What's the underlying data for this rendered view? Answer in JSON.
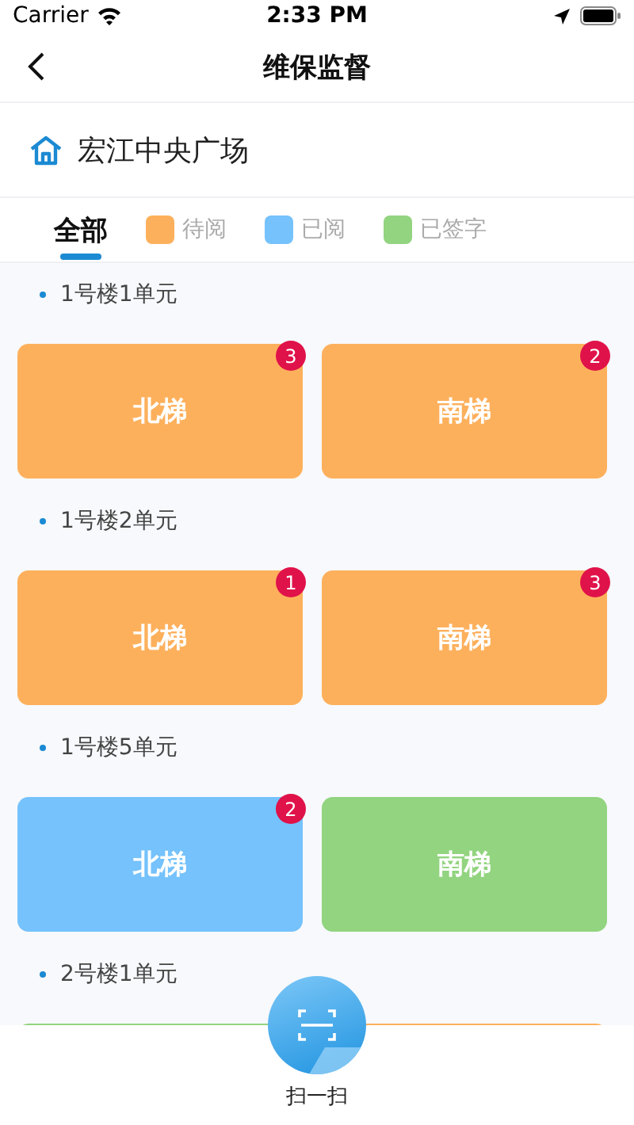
{
  "status_bar": {
    "carrier": "Carrier",
    "time": "2:33 PM"
  },
  "nav": {
    "title": "维保监督"
  },
  "location": {
    "name": "宏江中央广场"
  },
  "tabs": [
    {
      "label": "全部",
      "kind": "all",
      "selected": true
    },
    {
      "label": "待阅",
      "kind": "status",
      "color": "#fdb05c",
      "selected": false
    },
    {
      "label": "已阅",
      "kind": "status",
      "color": "#75c2fc",
      "selected": false
    },
    {
      "label": "已签字",
      "kind": "status",
      "color": "#92d47f",
      "selected": false
    }
  ],
  "groups": [
    {
      "title": "1号楼1单元",
      "units": [
        {
          "label": "北梯",
          "color": "#fdb05c",
          "badge": "3"
        },
        {
          "label": "南梯",
          "color": "#fdb05c",
          "badge": "2"
        }
      ]
    },
    {
      "title": "1号楼2单元",
      "units": [
        {
          "label": "北梯",
          "color": "#fdb05c",
          "badge": "1"
        },
        {
          "label": "南梯",
          "color": "#fdb05c",
          "badge": "3"
        }
      ]
    },
    {
      "title": "1号楼5单元",
      "units": [
        {
          "label": "北梯",
          "color": "#75c2fc",
          "badge": "2"
        },
        {
          "label": "南梯",
          "color": "#92d47f"
        }
      ]
    },
    {
      "title": "2号楼1单元",
      "units": [
        {
          "color": "#92d47f"
        },
        {
          "color": "#fdb05c"
        }
      ]
    }
  ],
  "scan": {
    "label": "扫一扫"
  }
}
